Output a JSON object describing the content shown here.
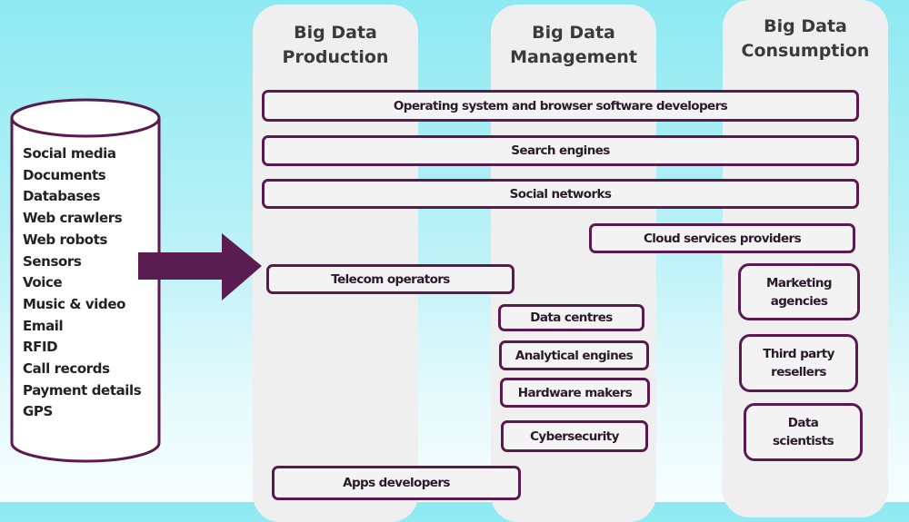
{
  "sources": {
    "items": [
      "Social media",
      "Documents",
      "Databases",
      "Web crawlers",
      "Web robots",
      "Sensors",
      "Voice",
      "Music & video",
      "Email",
      "RFID",
      "Call records",
      "Payment details",
      "GPS"
    ]
  },
  "columns": {
    "production": "Big Data Production",
    "management": "Big Data Management",
    "consumption": "Big Data Consumption"
  },
  "boxes": {
    "os": "Operating system and browser software developers",
    "search": "Search engines",
    "social": "Social networks",
    "cloud": "Cloud services providers",
    "telecom": "Telecom operators",
    "datacentres": "Data centres",
    "analytical": "Analytical engines",
    "hardware": "Hardware makers",
    "cyber": "Cybersecurity",
    "apps": "Apps developers",
    "marketing": "Marketing agencies",
    "resellers": "Third party resellers",
    "scientists": "Data scientists"
  },
  "colors": {
    "accent": "#5b1a4f",
    "column": "#efeff0",
    "background_top": "#8ee9f2"
  }
}
